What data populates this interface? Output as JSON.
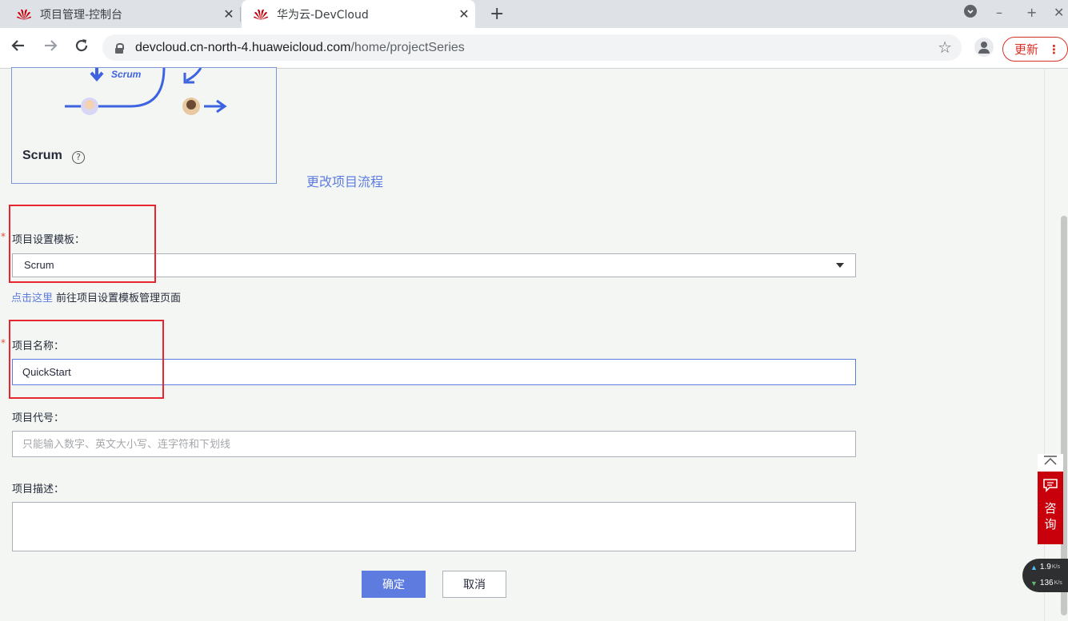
{
  "browser": {
    "tabs": [
      {
        "title": "项目管理-控制台",
        "active": false
      },
      {
        "title": "华为云-DevCloud",
        "active": true
      }
    ],
    "url_host": "devcloud.cn-north-4.huaweicloud.com",
    "url_path": "/home/projectSeries",
    "update_label": "更新"
  },
  "card": {
    "diagram_label": "Scrum",
    "name": "Scrum"
  },
  "change_flow_link": "更改项目流程",
  "form": {
    "template": {
      "label": "项目设置模板：",
      "value": "Scrum"
    },
    "hint": {
      "link": "点击这里",
      "text": "前往项目设置模板管理页面"
    },
    "name": {
      "label": "项目名称：",
      "value": "QuickStart"
    },
    "code": {
      "label": "项目代号：",
      "placeholder": "只能输入数字、英文大小写、连字符和下划线"
    },
    "desc": {
      "label": "项目描述："
    },
    "confirm_label": "确定",
    "cancel_label": "取消"
  },
  "consult_label": "咨询",
  "net_speed": {
    "up": "1.9",
    "down": "136",
    "unit": "K/s"
  },
  "colors": {
    "accent": "#5e7ce0",
    "huawei_red": "#c7000b",
    "highlight_box": "#e8262f"
  }
}
